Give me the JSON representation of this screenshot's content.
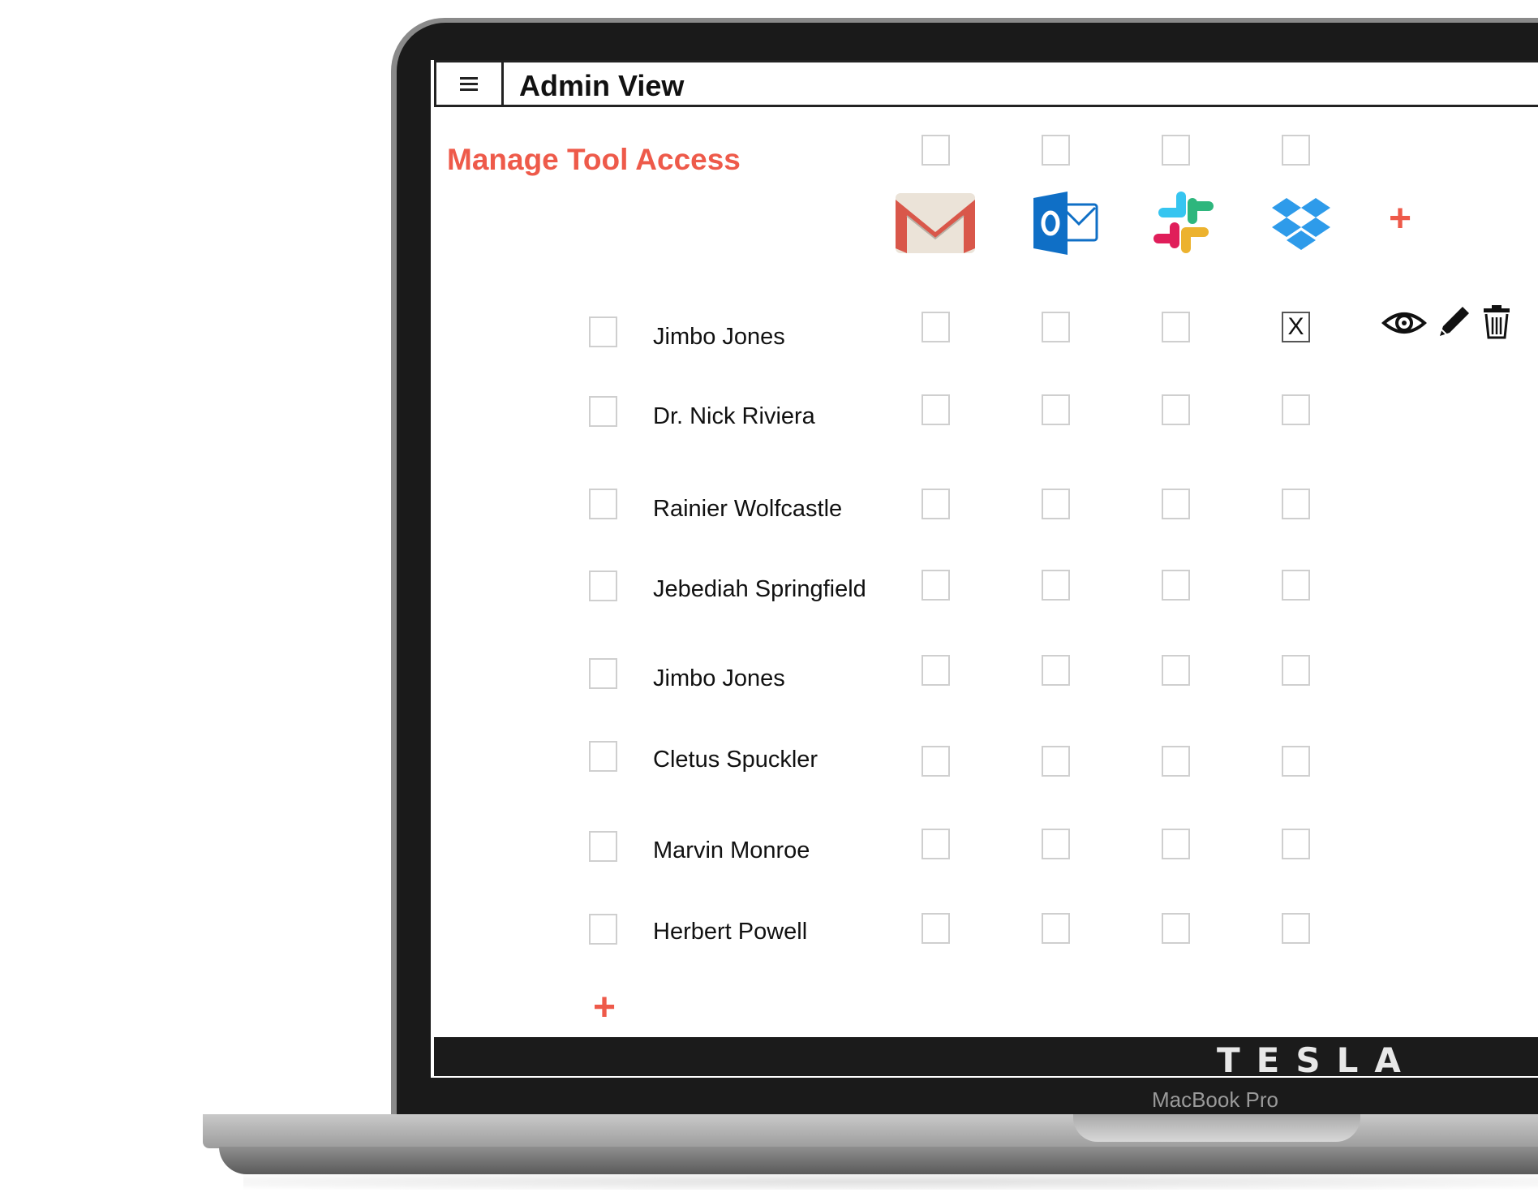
{
  "header": {
    "title": "Admin View",
    "menu_icon": "hamburger-menu-icon"
  },
  "page": {
    "title": "Manage Tool Access"
  },
  "tools": [
    {
      "name": "Gmail",
      "icon": "gmail-icon",
      "selected": false
    },
    {
      "name": "Outlook",
      "icon": "outlook-icon",
      "selected": false
    },
    {
      "name": "Slack",
      "icon": "slack-icon",
      "selected": false
    },
    {
      "name": "Dropbox",
      "icon": "dropbox-icon",
      "selected": false
    }
  ],
  "add_tool_label": "+",
  "users": [
    {
      "name": "Jimbo Jones",
      "access": [
        false,
        false,
        false,
        true
      ]
    },
    {
      "name": "Dr. Nick Riviera",
      "access": [
        false,
        false,
        false,
        false
      ]
    },
    {
      "name": "Rainier Wolfcastle",
      "access": [
        false,
        false,
        false,
        false
      ]
    },
    {
      "name": "Jebediah Springfield",
      "access": [
        false,
        false,
        false,
        false
      ]
    },
    {
      "name": "Jimbo Jones",
      "access": [
        false,
        false,
        false,
        false
      ]
    },
    {
      "name": "Cletus Spuckler",
      "access": [
        false,
        false,
        false,
        false
      ]
    },
    {
      "name": "Marvin Monroe",
      "access": [
        false,
        false,
        false,
        false
      ]
    },
    {
      "name": "Herbert Powell",
      "access": [
        false,
        false,
        false,
        false
      ]
    }
  ],
  "checked_mark": "X",
  "row_actions": [
    "eye-icon",
    "pencil-icon",
    "trash-icon"
  ],
  "add_user_label": "+",
  "footer": {
    "brand": "TESLA"
  },
  "device": {
    "label": "MacBook Pro"
  },
  "colors": {
    "accent": "#ee5a4a",
    "footer_bg": "#1b1b1b"
  }
}
